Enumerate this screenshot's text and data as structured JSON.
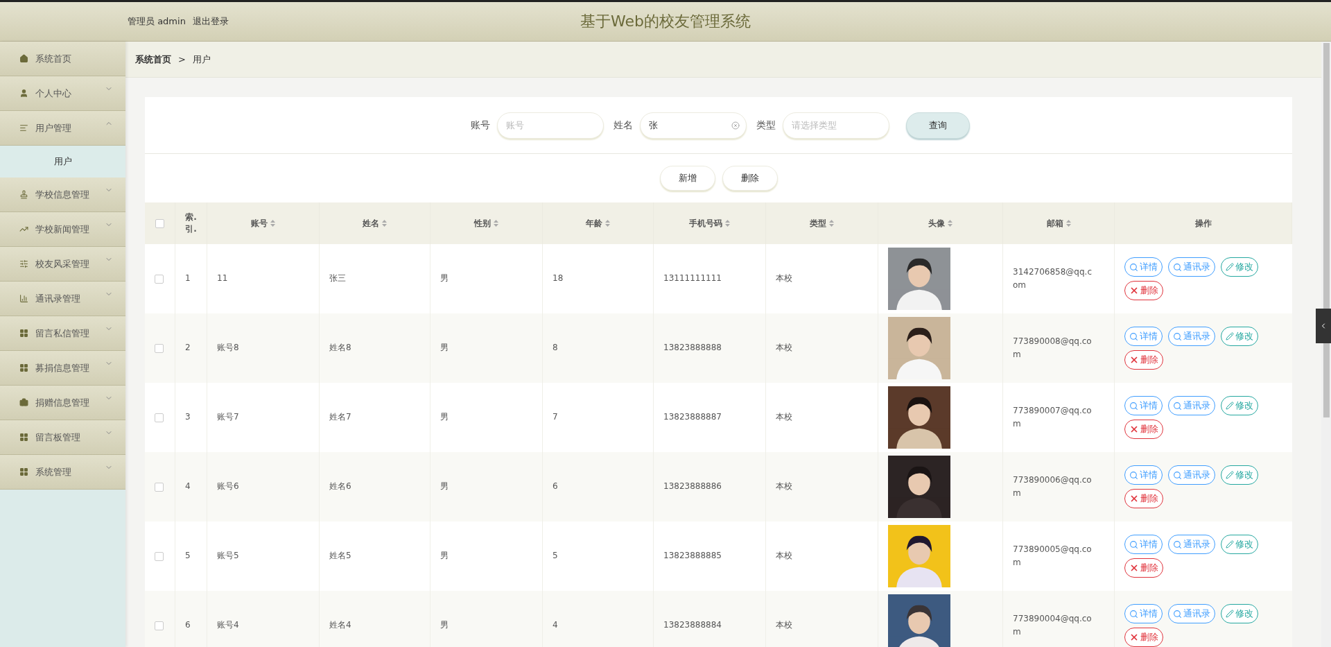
{
  "header": {
    "user": "管理员 admin",
    "logout": "退出登录",
    "title": "基于Web的校友管理系统"
  },
  "sidebar": {
    "items": [
      {
        "kind": "link",
        "label": "系统首页"
      },
      {
        "kind": "menu",
        "label": "个人中心",
        "expanded": false
      },
      {
        "kind": "menu",
        "label": "用户管理",
        "expanded": true,
        "children": [
          {
            "label": "用户",
            "selected": true
          }
        ]
      },
      {
        "kind": "menu",
        "label": "学校信息管理",
        "expanded": false
      },
      {
        "kind": "menu",
        "label": "学校新闻管理",
        "expanded": false
      },
      {
        "kind": "menu",
        "label": "校友风采管理",
        "expanded": false
      },
      {
        "kind": "menu",
        "label": "通讯录管理",
        "expanded": false
      },
      {
        "kind": "menu",
        "label": "留言私信管理",
        "expanded": false
      },
      {
        "kind": "menu",
        "label": "募捐信息管理",
        "expanded": false
      },
      {
        "kind": "menu",
        "label": "捐赠信息管理",
        "expanded": false
      },
      {
        "kind": "menu",
        "label": "留言板管理",
        "expanded": false
      },
      {
        "kind": "menu",
        "label": "系统管理",
        "expanded": false
      }
    ]
  },
  "breadcrumb": {
    "home": "系统首页",
    "separator": ">",
    "current": "用户"
  },
  "search": {
    "fields": [
      {
        "kind": "text",
        "label": "账号",
        "placeholder": "账号"
      },
      {
        "kind": "text",
        "label": "姓名",
        "value": "张"
      },
      {
        "kind": "select",
        "label": "类型",
        "placeholder": "请选择类型"
      }
    ],
    "button": "查询"
  },
  "actions": [
    "新增",
    "删除"
  ],
  "table": {
    "select_all": {
      "checked": false
    },
    "columns": [
      {
        "label": "索.引.",
        "sortable": false
      },
      {
        "label": "账号",
        "sortable": true
      },
      {
        "label": "姓名",
        "sortable": true
      },
      {
        "label": "性别",
        "sortable": true
      },
      {
        "label": "年龄",
        "sortable": true
      },
      {
        "label": "手机号码",
        "sortable": true
      },
      {
        "label": "类型",
        "sortable": true
      },
      {
        "label": "头像",
        "sortable": true
      },
      {
        "label": "邮箱",
        "sortable": true
      },
      {
        "label": "操作",
        "sortable": false
      }
    ],
    "rows": [
      {
        "checked": false,
        "index": "1",
        "account": "11",
        "name": "张三",
        "gender": "男",
        "age": "18",
        "phone": "13111111111",
        "type": "本校",
        "email": "3142706858@qq.com"
      },
      {
        "checked": false,
        "index": "2",
        "account": "账号8",
        "name": "姓名8",
        "gender": "男",
        "age": "8",
        "phone": "13823888888",
        "type": "本校",
        "email": "773890008@qq.com"
      },
      {
        "checked": false,
        "index": "3",
        "account": "账号7",
        "name": "姓名7",
        "gender": "男",
        "age": "7",
        "phone": "13823888887",
        "type": "本校",
        "email": "773890007@qq.com"
      },
      {
        "checked": false,
        "index": "4",
        "account": "账号6",
        "name": "姓名6",
        "gender": "男",
        "age": "6",
        "phone": "13823888886",
        "type": "本校",
        "email": "773890006@qq.com"
      },
      {
        "checked": false,
        "index": "5",
        "account": "账号5",
        "name": "姓名5",
        "gender": "男",
        "age": "5",
        "phone": "13823888885",
        "type": "本校",
        "email": "773890005@qq.com"
      },
      {
        "checked": false,
        "index": "6",
        "account": "账号4",
        "name": "姓名4",
        "gender": "男",
        "age": "4",
        "phone": "13823888884",
        "type": "本校",
        "email": "773890004@qq.com"
      }
    ],
    "row_actions": [
      [
        {
          "kind": "detail",
          "label": "详情"
        },
        {
          "kind": "contacts",
          "label": "通讯录"
        },
        {
          "kind": "edit",
          "label": "修改"
        },
        {
          "kind": "delete",
          "label": "删除"
        }
      ],
      [
        {
          "kind": "detail",
          "label": "详情"
        },
        {
          "kind": "contacts",
          "label": "通讯录"
        },
        {
          "kind": "edit",
          "label": "修改"
        },
        {
          "kind": "delete",
          "label": "删除"
        }
      ],
      [
        {
          "kind": "detail",
          "label": "详情"
        },
        {
          "kind": "contacts",
          "label": "通讯录"
        },
        {
          "kind": "edit",
          "label": "修改"
        },
        {
          "kind": "delete",
          "label": "删除"
        }
      ],
      [
        {
          "kind": "detail",
          "label": "详情"
        },
        {
          "kind": "contacts",
          "label": "通讯录"
        },
        {
          "kind": "edit",
          "label": "修改"
        },
        {
          "kind": "delete",
          "label": "删除"
        }
      ],
      [
        {
          "kind": "detail",
          "label": "详情"
        },
        {
          "kind": "contacts",
          "label": "通讯录"
        },
        {
          "kind": "edit",
          "label": "修改"
        },
        {
          "kind": "delete",
          "label": "删除"
        }
      ],
      [
        {
          "kind": "detail",
          "label": "详情"
        },
        {
          "kind": "contacts",
          "label": "通讯录"
        },
        {
          "kind": "edit",
          "label": "修改"
        },
        {
          "kind": "delete",
          "label": "删除"
        }
      ]
    ]
  }
}
